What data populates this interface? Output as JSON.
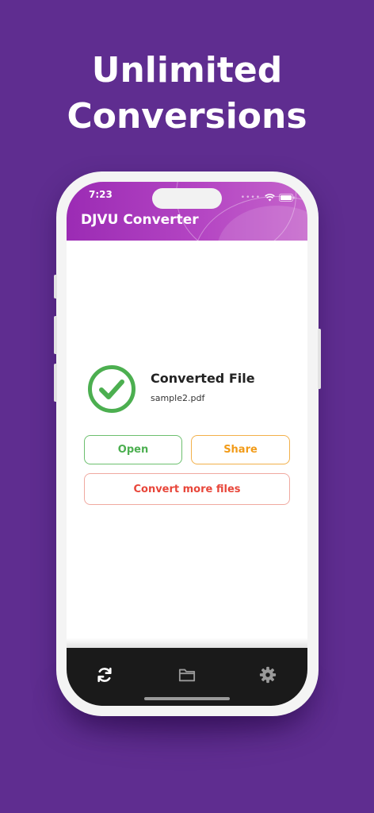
{
  "promo": {
    "headline_line1": "Unlimited",
    "headline_line2": "Conversions"
  },
  "status_bar": {
    "time": "7:23",
    "icons": [
      "signal-dots-icon",
      "wifi-icon",
      "battery-icon"
    ]
  },
  "app_bar": {
    "title": "DJVU Converter"
  },
  "result": {
    "title": "Converted File",
    "filename": "sample2.pdf",
    "icon": "check-circle-icon"
  },
  "actions": {
    "open_label": "Open",
    "share_label": "Share",
    "convert_more_label": "Convert more files"
  },
  "tab_bar": {
    "items": [
      {
        "icon": "sync-icon",
        "active": true
      },
      {
        "icon": "folder-icon",
        "active": false
      },
      {
        "icon": "gear-icon",
        "active": false
      }
    ]
  },
  "colors": {
    "background": "#5f2d90",
    "app_bar_start": "#9b2bb4",
    "app_bar_end": "#c564cb",
    "success": "#4caf50",
    "share": "#f29b18",
    "convert_more": "#e8463a",
    "tab_bar": "#1a1a1a"
  }
}
